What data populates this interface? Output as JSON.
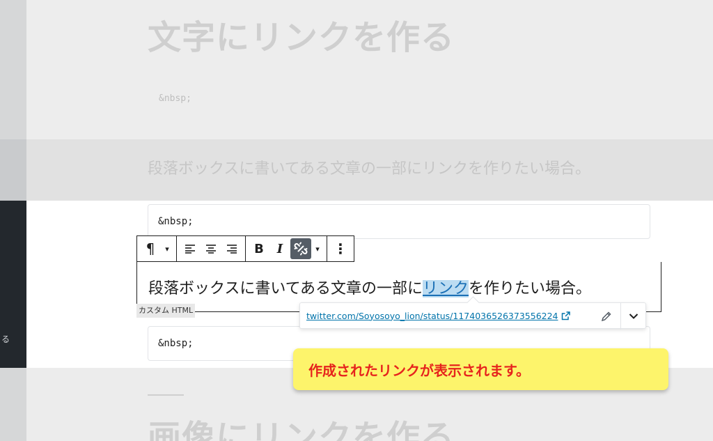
{
  "sidebar": {
    "item_fragment": "る"
  },
  "background": {
    "heading_top": "文字にリンクを作る",
    "nbsp_top": "&nbsp;",
    "paragraph_top": "段落ボックスに書いてある文章の一部にリンクを作りたい場合。",
    "heading_bottom": "画像にリンクを作る"
  },
  "editor": {
    "nbsp_block_1": "&nbsp;",
    "nbsp_block_2": "&nbsp;",
    "block_type_label": "カスタム HTML",
    "paragraph": {
      "before": "段落ボックスに書いてある文章の一部に",
      "link_text": "リンク",
      "after": "を作りたい場合。"
    }
  },
  "toolbar": {
    "paragraph_symbol": "¶",
    "dropdown_caret": "▾",
    "bold": "B",
    "italic": "I",
    "more_caret": "▾",
    "options": "⋮"
  },
  "link_popover": {
    "url": "twitter.com/Soyosoyo_lion/status/1174036526373556224"
  },
  "callout": {
    "text": "作成されたリンクが表示されます。"
  }
}
